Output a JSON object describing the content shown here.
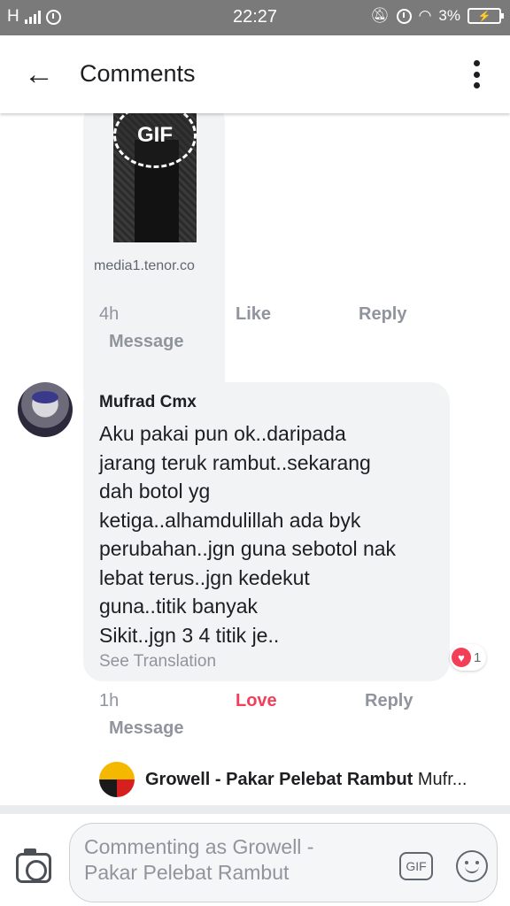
{
  "status_bar": {
    "network": "H",
    "time": "22:27",
    "battery": "3%"
  },
  "header": {
    "title": "Comments"
  },
  "gif_comment": {
    "badge": "GIF",
    "source": "media1.tenor.co",
    "time": "4h",
    "like": "Like",
    "reply": "Reply",
    "message": "Message"
  },
  "comment": {
    "author": "Mufrad Cmx",
    "text": "Aku pakai pun ok..daripada\njarang teruk rambut..sekarang\ndah botol yg\nketiga..alhamdulillah ada byk\nperubahan..jgn guna sebotol nak\nlebat terus..jgn kedekut\nguna..titik banyak\nSikit..jgn 3 4 titik je..",
    "see_translation": "See Translation",
    "reaction_count": "1",
    "time": "1h",
    "love": "Love",
    "reply": "Reply",
    "message": "Message"
  },
  "reply_preview": {
    "author": "Growell - Pakar Pelebat Rambut",
    "snippet": "Mufr..."
  },
  "composer": {
    "placeholder": "Commenting as Growell -\nPakar Pelebat Rambut",
    "gif_label": "GIF"
  },
  "colors": {
    "love": "#f33e58",
    "bubble": "#f2f3f5",
    "status_bar": "#7a7a7a"
  }
}
